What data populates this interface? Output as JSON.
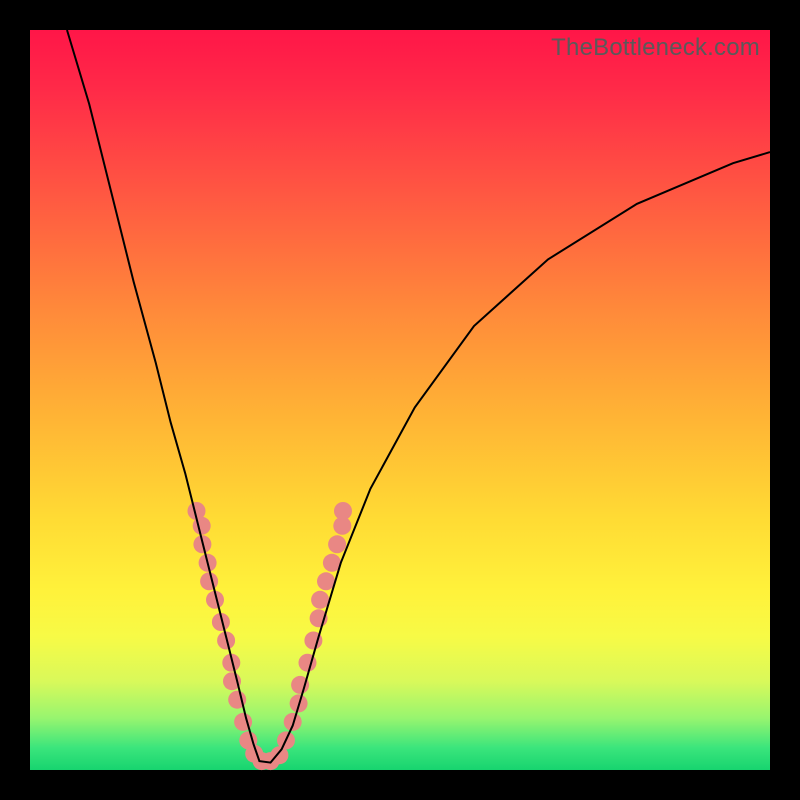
{
  "watermark": "TheBottleneck.com",
  "colors": {
    "dot": "#e98784",
    "curve": "#000000",
    "frame": "#000000"
  },
  "chart_data": {
    "type": "line",
    "title": "",
    "xlabel": "",
    "ylabel": "",
    "xlim": [
      0,
      100
    ],
    "ylim": [
      0,
      100
    ],
    "grid": false,
    "legend": null,
    "series": [
      {
        "name": "bottleneck-curve",
        "x": [
          5,
          8,
          11,
          14,
          17,
          19,
          21,
          23,
          25,
          26.5,
          28,
          29.2,
          30.2,
          31,
          32.5,
          34,
          35.5,
          37,
          39,
          42,
          46,
          52,
          60,
          70,
          82,
          95,
          100
        ],
        "y": [
          100,
          90,
          78,
          66,
          55,
          47,
          40,
          32,
          24,
          18,
          12,
          7,
          3.5,
          1.2,
          1.0,
          2.8,
          6,
          11,
          18,
          28,
          38,
          49,
          60,
          69,
          76.5,
          82,
          83.5
        ]
      }
    ],
    "annotations": {
      "dot_cluster": {
        "description": "salmon scatter dots concentrated near curve trough and lower flanks",
        "points": [
          {
            "x": 22.5,
            "y": 35
          },
          {
            "x": 23.2,
            "y": 33
          },
          {
            "x": 23.3,
            "y": 30.5
          },
          {
            "x": 24.0,
            "y": 28
          },
          {
            "x": 24.2,
            "y": 25.5
          },
          {
            "x": 25.0,
            "y": 23
          },
          {
            "x": 25.8,
            "y": 20
          },
          {
            "x": 26.5,
            "y": 17.5
          },
          {
            "x": 27.2,
            "y": 14.5
          },
          {
            "x": 27.3,
            "y": 12
          },
          {
            "x": 28.0,
            "y": 9.5
          },
          {
            "x": 28.8,
            "y": 6.5
          },
          {
            "x": 29.5,
            "y": 4
          },
          {
            "x": 30.3,
            "y": 2.2
          },
          {
            "x": 31.3,
            "y": 1.2
          },
          {
            "x": 32.5,
            "y": 1.2
          },
          {
            "x": 33.7,
            "y": 2.0
          },
          {
            "x": 34.6,
            "y": 4.0
          },
          {
            "x": 35.5,
            "y": 6.5
          },
          {
            "x": 36.3,
            "y": 9.0
          },
          {
            "x": 36.5,
            "y": 11.5
          },
          {
            "x": 37.5,
            "y": 14.5
          },
          {
            "x": 38.3,
            "y": 17.5
          },
          {
            "x": 39.0,
            "y": 20.5
          },
          {
            "x": 39.2,
            "y": 23.0
          },
          {
            "x": 40.0,
            "y": 25.5
          },
          {
            "x": 40.8,
            "y": 28.0
          },
          {
            "x": 41.5,
            "y": 30.5
          },
          {
            "x": 42.2,
            "y": 33.0
          },
          {
            "x": 42.3,
            "y": 35.0
          }
        ]
      }
    }
  }
}
